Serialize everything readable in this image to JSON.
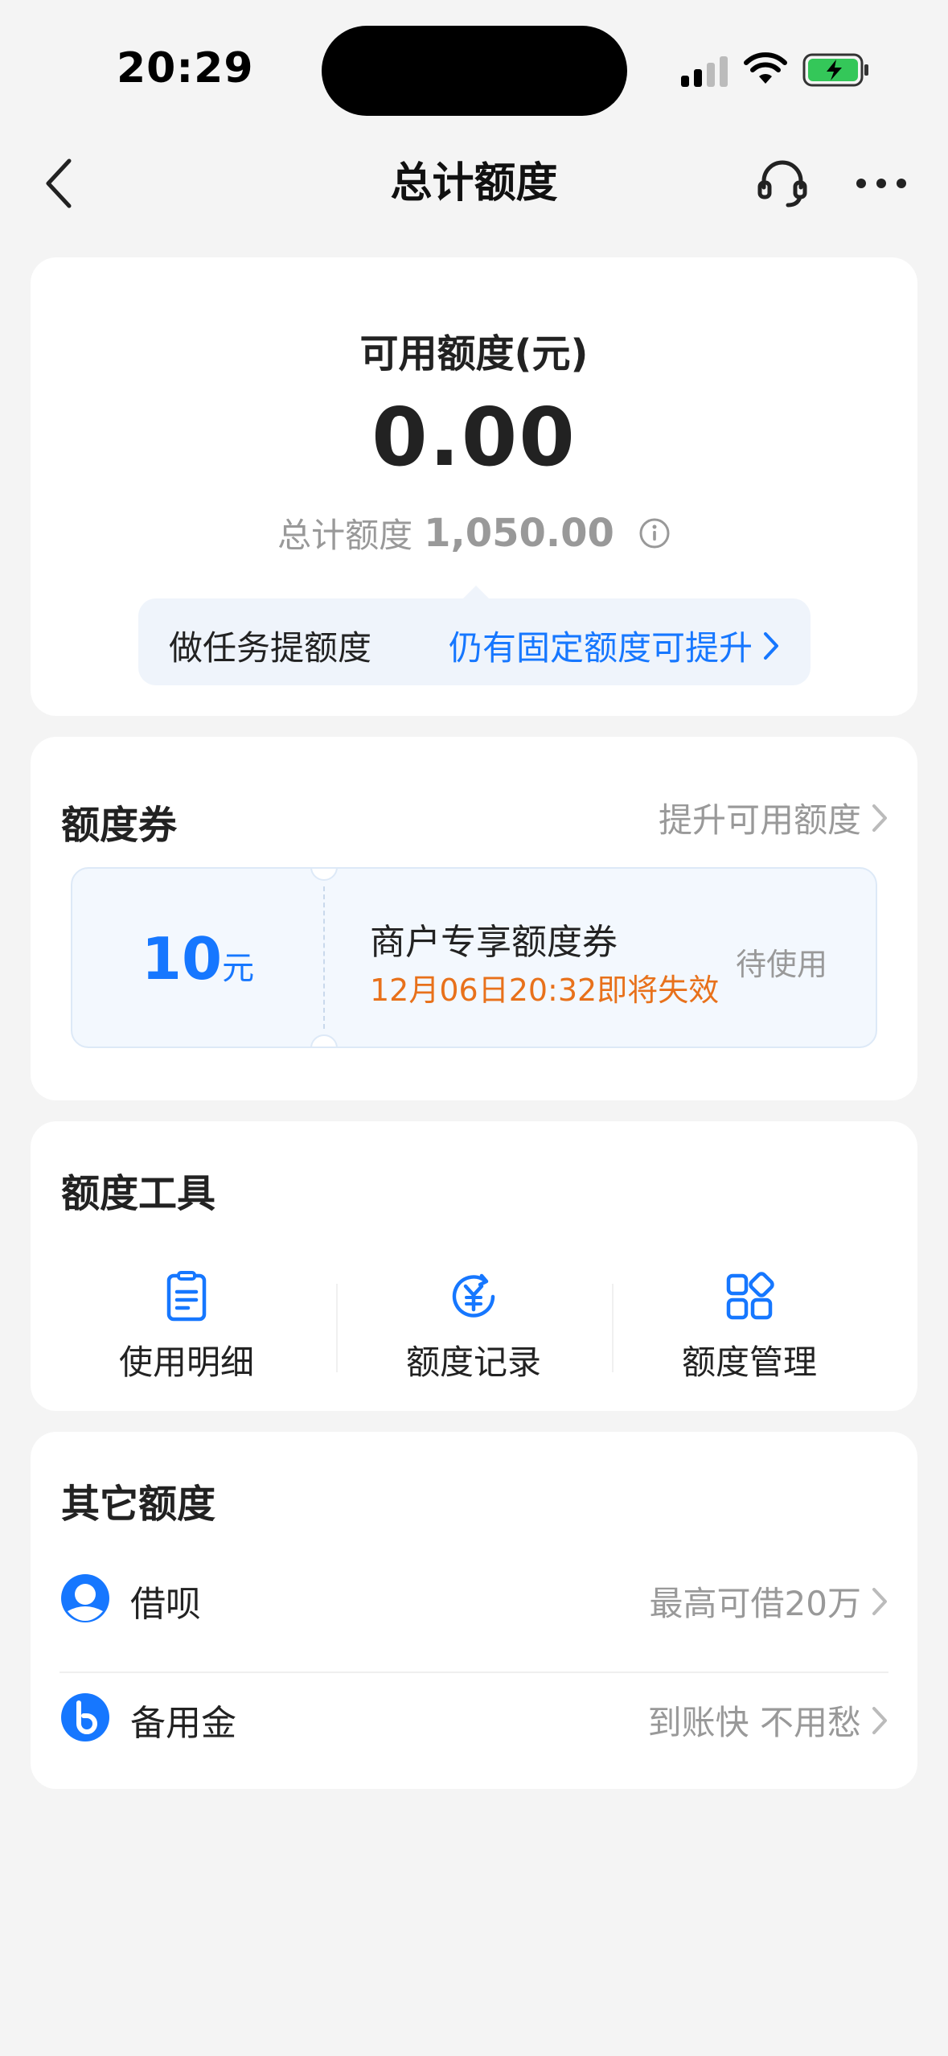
{
  "status": {
    "time": "20:29"
  },
  "nav": {
    "title": "总计额度"
  },
  "available": {
    "label": "可用额度(元)",
    "value": "0.00",
    "total_label": "总计额度",
    "total_value": "1,050.00",
    "task_left": "做任务提额度",
    "task_right": "仍有固定额度可提升"
  },
  "coupon_section": {
    "title": "额度券",
    "more": "提升可用额度",
    "coupon": {
      "amount": "10",
      "unit": "元",
      "name": "商户专享额度券",
      "expire": "12月06日20:32即将失效",
      "status": "待使用"
    }
  },
  "tools": {
    "title": "额度工具",
    "items": [
      {
        "label": "使用明细",
        "icon": "list-document-icon"
      },
      {
        "label": "额度记录",
        "icon": "yuan-refresh-icon"
      },
      {
        "label": "额度管理",
        "icon": "grid-manage-icon"
      }
    ]
  },
  "other": {
    "title": "其它额度",
    "items": [
      {
        "label": "借呗",
        "right": "最高可借20万",
        "icon": "jiebei-icon"
      },
      {
        "label": "备用金",
        "right": "到账快 不用愁",
        "icon": "beiyongjin-icon"
      }
    ]
  },
  "colors": {
    "accent": "#1677ff",
    "warning": "#e8711b",
    "muted": "#999999",
    "background": "#f4f4f4"
  }
}
